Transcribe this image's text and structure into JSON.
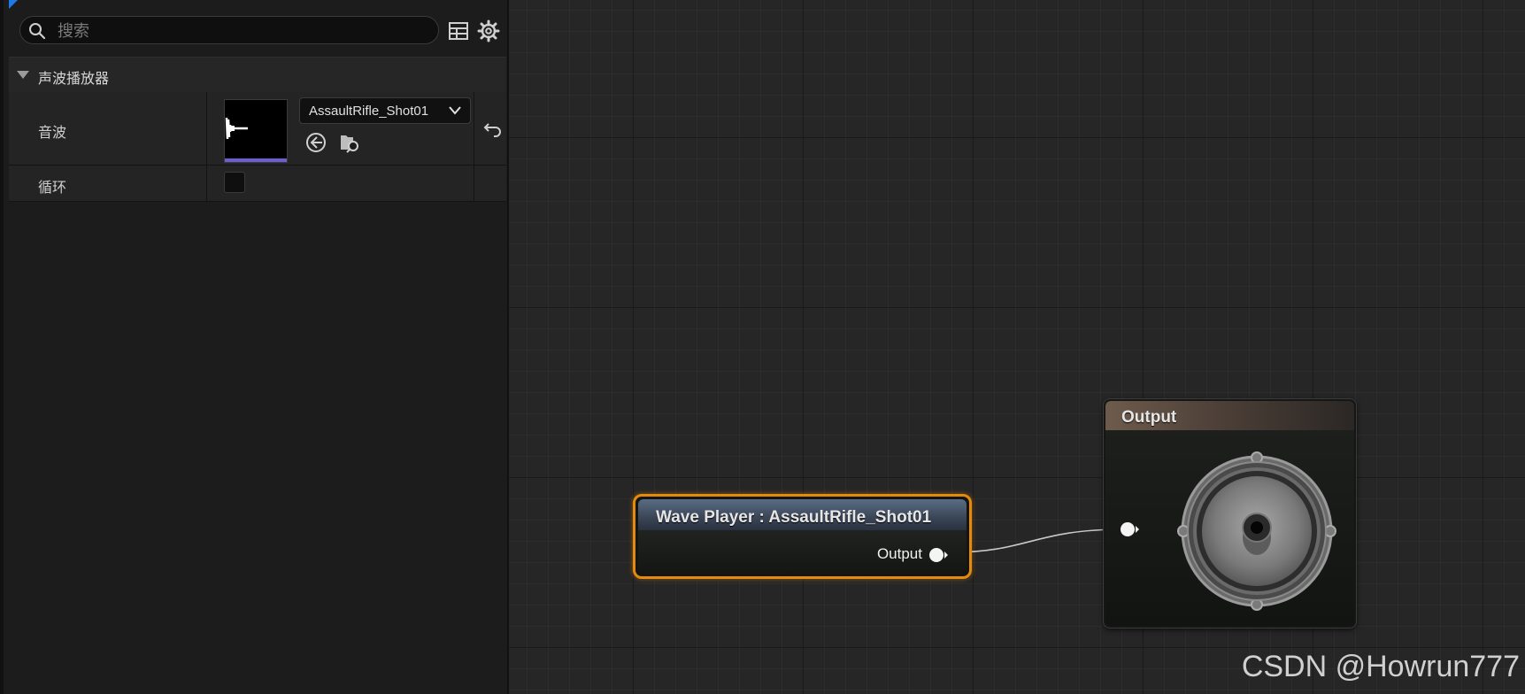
{
  "details_panel": {
    "search": {
      "placeholder": "搜索",
      "value": ""
    },
    "toolbar": {
      "table_icon": "table-view-icon",
      "settings_icon": "gear-icon"
    },
    "category": {
      "label": "声波播放器",
      "expanded": true
    },
    "properties": [
      {
        "name": "音波",
        "asset": "AssaultRifle_Shot01",
        "actions": [
          "use-selected-icon",
          "browse-asset-icon"
        ],
        "reset_icon": "reset-arrow-icon"
      },
      {
        "name": "循环",
        "checked": false
      }
    ]
  },
  "graph": {
    "nodes": {
      "wave_player": {
        "title": "Wave Player : AssaultRifle_Shot01",
        "output_pin": "Output",
        "selected": true
      },
      "output": {
        "title": "Output",
        "icon": "speaker-icon"
      }
    }
  },
  "colors": {
    "selection": "#e48a0c",
    "category_accent": "#1e78e8",
    "thumbnail_bar": "#6b5fd0"
  },
  "watermark": "CSDN @Howrun777"
}
